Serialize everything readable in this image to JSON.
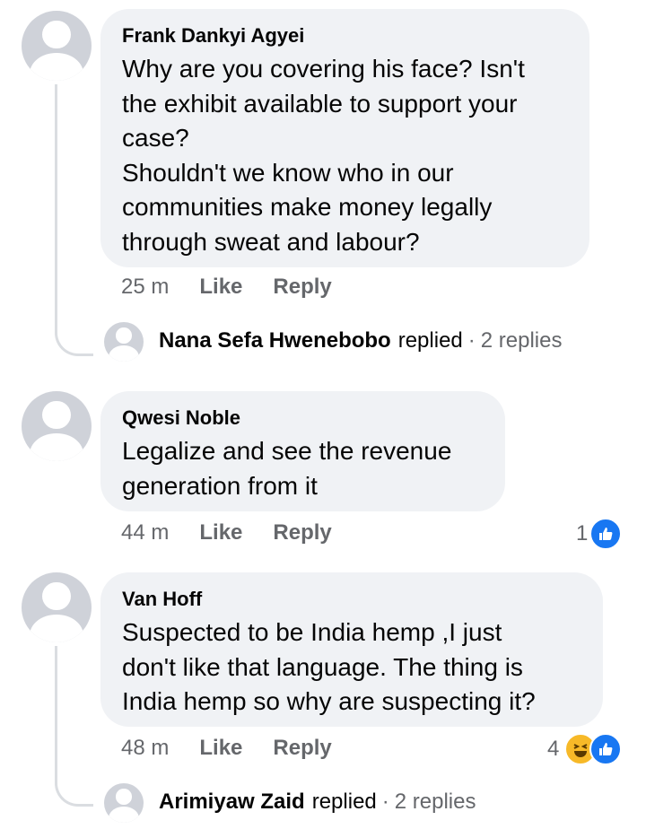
{
  "comments": [
    {
      "author": "Frank Dankyi Agyei",
      "text": "Why are you covering his face? Isn't\nthe exhibit available to support your\ncase?\nShouldn't we know who in our\ncommunities make money legally\nthrough sweat and labour?",
      "time": "25 m",
      "like_label": "Like",
      "reply_label": "Reply",
      "reply_summary": {
        "name": "Nana Sefa Hwenebobo",
        "verb": "replied",
        "separator": "·",
        "count": "2 replies"
      }
    },
    {
      "author": "Qwesi Noble",
      "text": "Legalize and see the revenue\ngeneration from it",
      "time": "44 m",
      "like_label": "Like",
      "reply_label": "Reply",
      "reaction_count": "1",
      "reactions": [
        "like-icon"
      ]
    },
    {
      "author": "Van Hoff",
      "text": "Suspected to be India hemp ,I just\ndon't like that language. The thing is\nIndia hemp so why are suspecting it?",
      "time": "48 m",
      "like_label": "Like",
      "reply_label": "Reply",
      "reaction_count": "4",
      "reactions": [
        "haha-icon",
        "like-icon"
      ],
      "reply_summary": {
        "name": "Arimiyaw Zaid",
        "verb": "replied",
        "separator": "·",
        "count": "2 replies"
      }
    }
  ],
  "colors": {
    "bubble": "#f0f2f5",
    "meta": "#65676b",
    "like": "#1877f2",
    "haha": "#f7b928"
  }
}
